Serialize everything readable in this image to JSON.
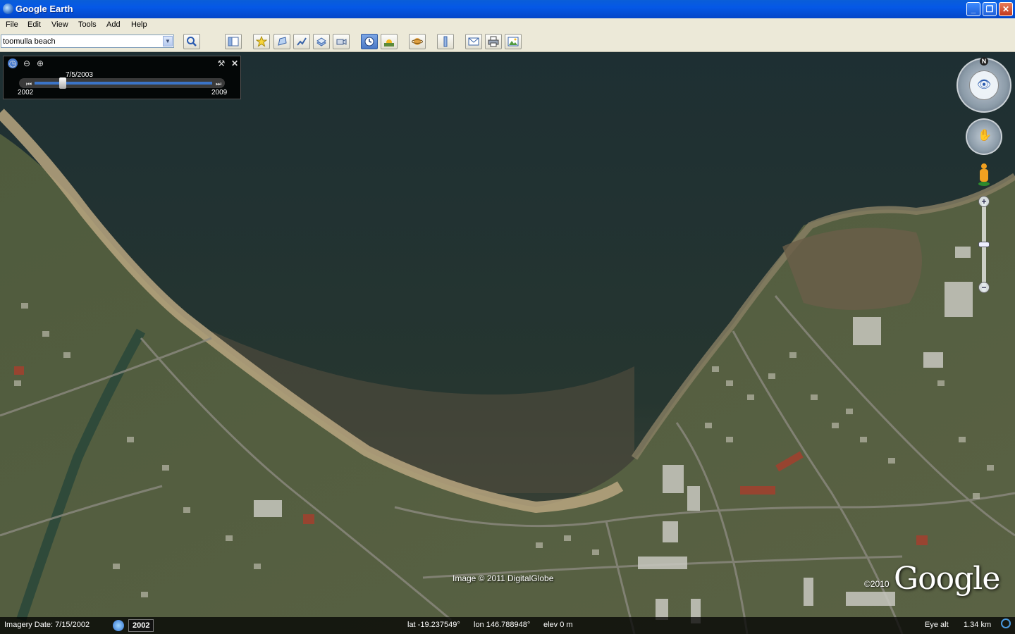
{
  "window": {
    "title": "Google Earth"
  },
  "menu": [
    "File",
    "Edit",
    "View",
    "Tools",
    "Add",
    "Help"
  ],
  "search": {
    "value": "toomulla beach"
  },
  "toolbar_icons": [
    "search-icon",
    "sidebar-icon",
    "placemark-icon",
    "polygon-icon",
    "path-icon",
    "overlay-icon",
    "record-tour-icon",
    "historical-imagery-icon",
    "sunlight-icon",
    "planets-icon",
    "ruler-icon",
    "email-icon",
    "print-icon",
    "save-image-icon"
  ],
  "time_slider": {
    "current_date": "7/5/2003",
    "start_label": "2002",
    "end_label": "2009",
    "position": 0.15
  },
  "nav": {
    "north_label": "N"
  },
  "map": {
    "copyright": "Image © 2011 DigitalGlobe",
    "brand_year": "©2010",
    "brand": "Google"
  },
  "status": {
    "imagery_date": "Imagery Date: 7/15/2002",
    "year_badge": "2002",
    "lat": "lat  -19.237549°",
    "lon": "lon  146.788948°",
    "elev": "elev    0 m",
    "eye_alt_label": "Eye alt",
    "eye_alt_value": "1.34 km"
  }
}
